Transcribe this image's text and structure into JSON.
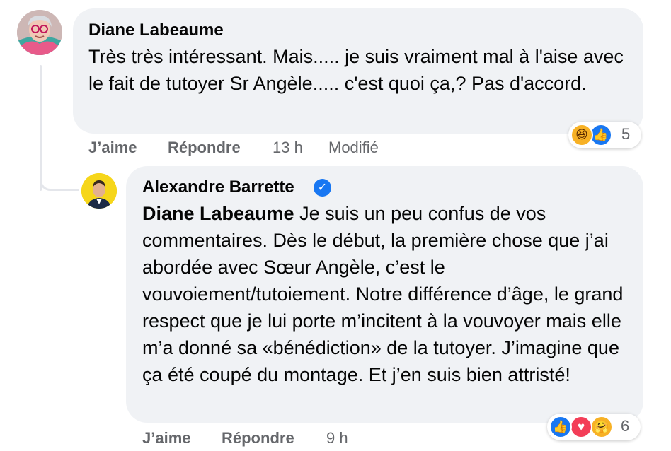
{
  "comments": [
    {
      "author": "Diane Labeaume",
      "text": "Très très intéressant. Mais..... je suis vraiment mal à l'aise avec le fait de tutoyer Sr Angèle..... c'est quoi ça,? Pas d'accord.",
      "like_label": "J’aime",
      "reply_label": "Répondre",
      "time": "13 h",
      "edited_label": "Modifié",
      "reaction_count": "5",
      "reactions": [
        "haha-icon",
        "like-icon"
      ]
    },
    {
      "author": "Alexandre Barrette",
      "verified_icon": "verified-check-icon",
      "mention": "Diane Labeaume",
      "text": " Je suis un peu confus de vos commentaires. Dès le début, la première chose que j’ai abordée avec Sœur Angèle, c’est le vouvoiement/tutoiement. Notre différence d’âge, le grand respect que je lui porte m’incitent à la vouvoyer mais elle m’a donné sa «bénédiction» de la tutoyer. J’imagine que ça été coupé du montage. Et j’en suis bien attristé!",
      "like_label": "J’aime",
      "reply_label": "Répondre",
      "time": "9 h",
      "reaction_count": "6",
      "reactions": [
        "like-icon",
        "love-icon",
        "care-icon"
      ]
    }
  ],
  "colors": {
    "bubble": "#f0f2f5",
    "secondary_text": "#65676b",
    "like_blue": "#1877f2",
    "love_red": "#f33e58",
    "haha_yellow": "#f7b125"
  }
}
